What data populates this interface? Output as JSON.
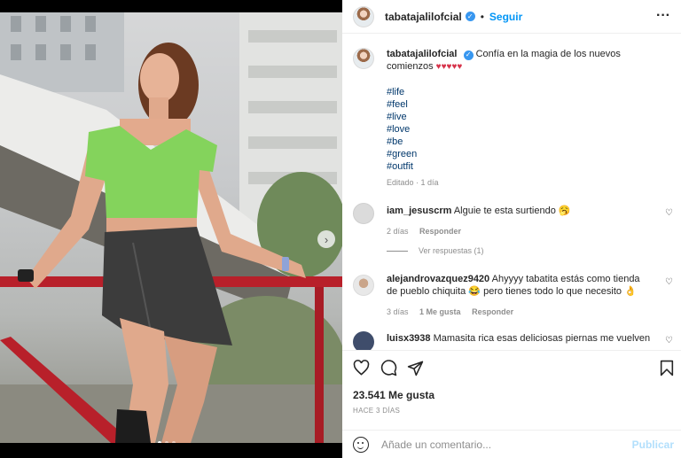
{
  "post": {
    "username": "tabatajalilofcial",
    "follow_label": "Seguir",
    "separator": "•",
    "more_glyph": "···"
  },
  "caption": {
    "username": "tabatajalilofcial",
    "text": "Confía en la magia de los nuevos comienzos",
    "hearts": "♥♥♥♥♥",
    "hashtags": [
      "#life",
      "#feel",
      "#live",
      "#love",
      "#be",
      "#green",
      "#outfit"
    ],
    "edited": "Editado · 1 día"
  },
  "comments": [
    {
      "username": "iam_jesuscrm",
      "text": "Alguie te esta surtiendo 🥱",
      "time": "2 días",
      "likes": "",
      "reply": "Responder",
      "view_replies": "Ver respuestas (1)"
    },
    {
      "username": "alejandrovazquez9420",
      "text": "Ahyyyy tabatita estás como tienda de pueblo chiquita 😂 pero tienes todo lo que necesito 👌",
      "time": "3 días",
      "likes": "1 Me gusta",
      "reply": "Responder"
    },
    {
      "username": "luisx3938",
      "text": "Mamasita rica esas deliciosas piernas me vuelven",
      "time": "",
      "likes": "",
      "reply": ""
    }
  ],
  "actions": {
    "likes": "23.541 Me gusta",
    "time_ago": "HACE 3 DÍAS"
  },
  "add_comment": {
    "placeholder": "Añade un comentario...",
    "publish": "Publicar"
  },
  "carousel": {
    "total": 3,
    "active": 1
  },
  "colors": {
    "accent": "#0095f6",
    "hashtag": "#00376b",
    "top_green": "#7fd35a",
    "skirt": "#3a3a3a"
  }
}
